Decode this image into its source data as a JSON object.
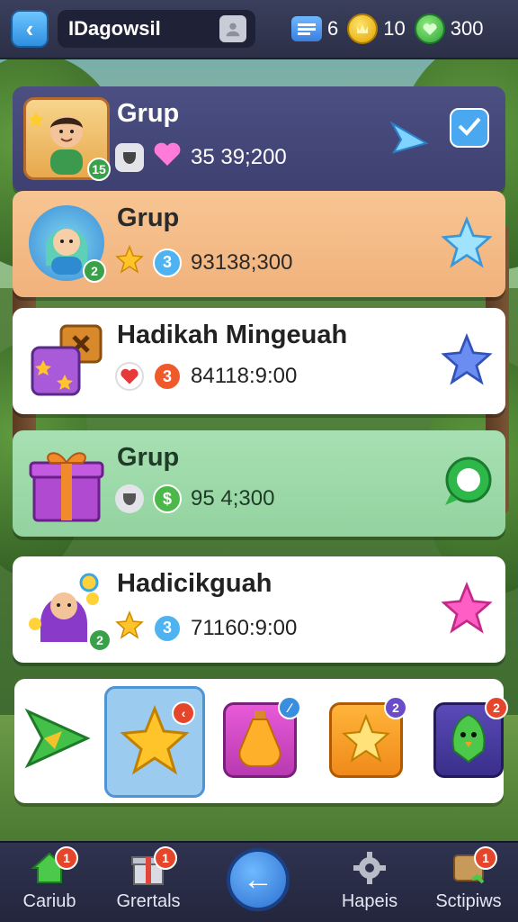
{
  "topbar": {
    "username": "IDagowsil",
    "messages_count": "6",
    "gold_count": "10",
    "gems_count": "300",
    "icons": {
      "back": "chevron-left-icon",
      "avatar": "user-avatar-icon",
      "messages": "message-icon",
      "gold": "gold-coin-icon",
      "gems": "green-gem-icon"
    }
  },
  "list": [
    {
      "title": "Grup",
      "score": "35 39;200",
      "badge": "15",
      "meta_icons": [
        "cup-icon",
        "heart-icon"
      ],
      "action": "check-icon"
    },
    {
      "title": "Grup",
      "score": "93138;300",
      "badge": "2",
      "coin": "3",
      "meta_icons": [
        "star-icon",
        "coin-3-icon"
      ],
      "action": "star-icon"
    },
    {
      "title": "Hadikah Mingeuah",
      "score": "84118:9:00",
      "coin": "3",
      "meta_icons": [
        "heart-icon",
        "coin-3-icon"
      ],
      "action": "star-icon"
    },
    {
      "title": "Grup",
      "score": "95 4;300",
      "coin": "$",
      "meta_icons": [
        "cup-icon",
        "dollar-coin-icon"
      ],
      "action": "chat-bubble-icon"
    },
    {
      "title": "Hadicikguah",
      "score": "71160:9:00",
      "badge": "2",
      "coin": "3",
      "meta_icons": [
        "star-icon",
        "coin-3-icon"
      ],
      "action": "star-icon"
    }
  ],
  "powerups": [
    {
      "name": "arrow-boost",
      "badge": ""
    },
    {
      "name": "star-boost",
      "badge": "‹",
      "selected": true
    },
    {
      "name": "potion-boost",
      "badge": "∕"
    },
    {
      "name": "orange-star-boost",
      "badge": "2"
    },
    {
      "name": "bird-boost",
      "badge": "2"
    }
  ],
  "bottomnav": {
    "items": [
      {
        "label": "Cariub",
        "badge": "1",
        "icon": "home-icon"
      },
      {
        "label": "Grertals",
        "badge": "1",
        "icon": "gift-box-icon"
      },
      {
        "label": "Hapeis",
        "badge": "",
        "icon": "gear-icon"
      },
      {
        "label": "Sctipiws",
        "badge": "1",
        "icon": "scroll-icon"
      }
    ],
    "center_icon": "back-arrow-icon",
    "center_glyph": "←"
  },
  "colors": {
    "accent": "#2f8ee0",
    "badge_red": "#e5452b",
    "badge_purple": "#6a4bc9"
  }
}
